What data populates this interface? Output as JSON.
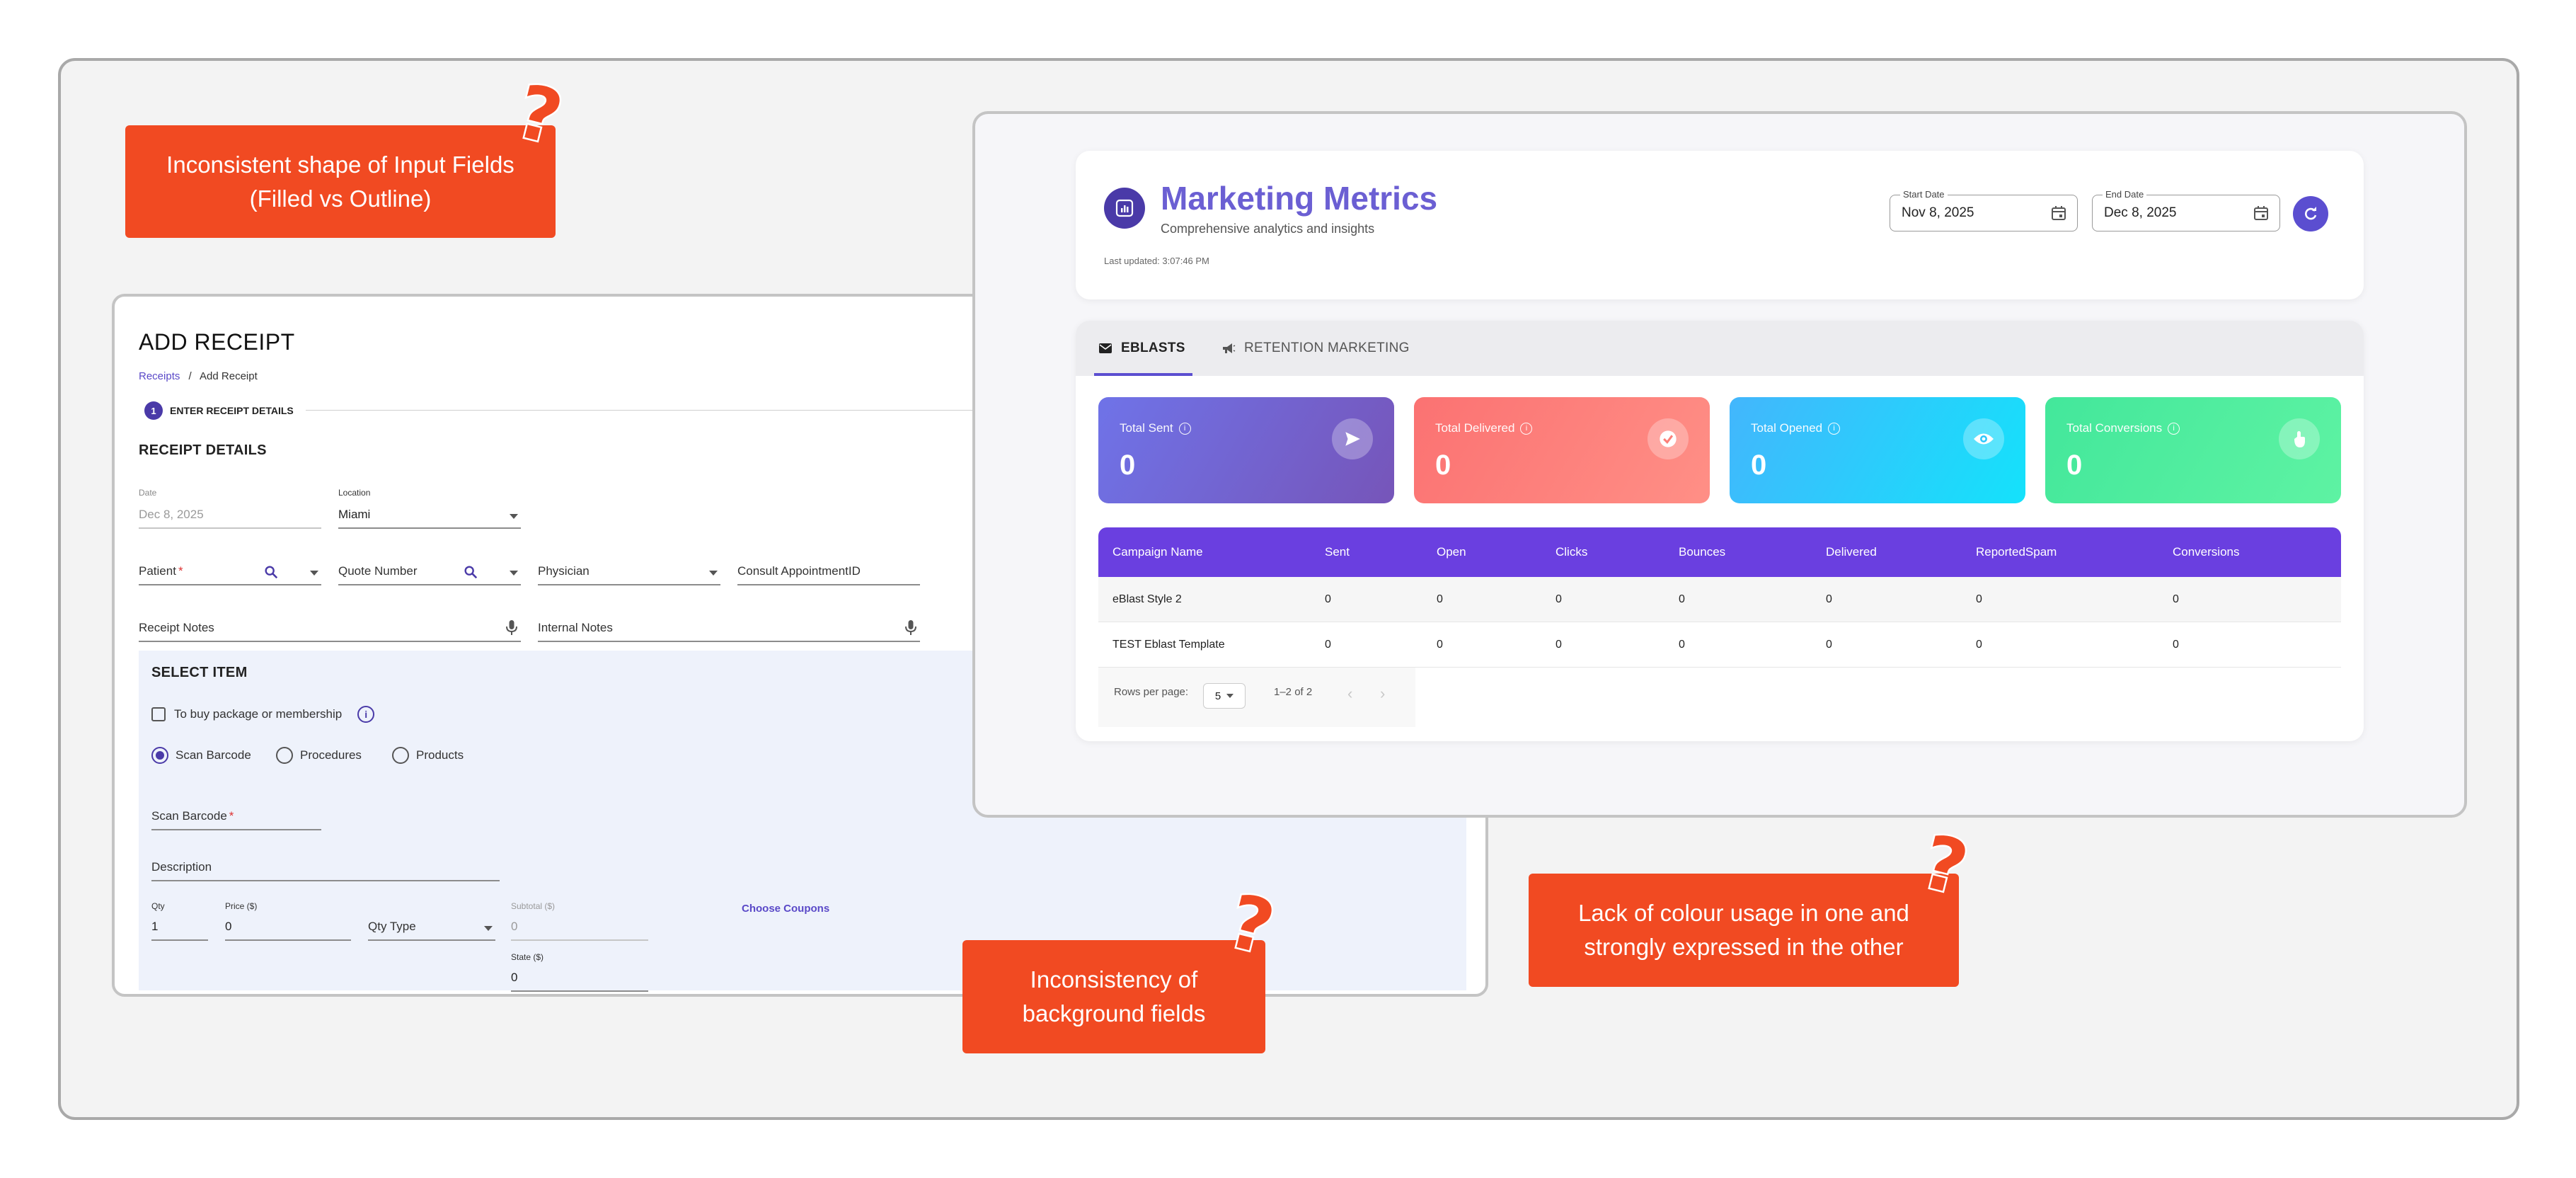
{
  "callouts": {
    "input_fields": "Inconsistent shape of Input Fields\n(Filled vs Outline)",
    "background_fields": "Inconsistency of\nbackground fields",
    "colour_usage": "Lack of colour usage in one and\nstrongly expressed in the other",
    "question_mark": "?"
  },
  "receipt": {
    "title": "ADD RECEIPT",
    "breadcrumb": {
      "link": "Receipts",
      "separator": "/",
      "current": "Add Receipt"
    },
    "step": {
      "number": "1",
      "label": "ENTER RECEIPT DETAILS"
    },
    "section_title": "RECEIPT DETAILS",
    "fields": {
      "date": {
        "label": "Date",
        "value": "Dec 8, 2025"
      },
      "location": {
        "label": "Location",
        "value": "Miami"
      },
      "patient": {
        "placeholder": "Patient",
        "required": "*"
      },
      "quote_number": {
        "placeholder": "Quote Number"
      },
      "physician": {
        "placeholder": "Physician"
      },
      "consult_appointment": {
        "placeholder": "Consult AppointmentID"
      },
      "receipt_notes": {
        "placeholder": "Receipt Notes"
      },
      "internal_notes": {
        "placeholder": "Internal Notes"
      }
    },
    "select_item": {
      "title": "SELECT ITEM",
      "package_checkbox": "To buy package or membership",
      "info": "i",
      "radios": [
        "Scan Barcode",
        "Procedures",
        "Products"
      ],
      "selected_radio": "Scan Barcode",
      "scan_barcode": {
        "placeholder": "Scan Barcode",
        "required": "*"
      },
      "description": {
        "placeholder": "Description"
      },
      "qty": {
        "label": "Qty",
        "value": "1"
      },
      "price": {
        "label": "Price ($)",
        "value": "0"
      },
      "qty_type": {
        "placeholder": "Qty Type"
      },
      "subtotal": {
        "label": "Subtotal ($)",
        "value": "0"
      },
      "state": {
        "label": "State ($)",
        "value": "0"
      },
      "choose_coupons": "Choose Coupons"
    }
  },
  "metrics": {
    "title": "Marketing Metrics",
    "subtitle": "Comprehensive analytics and insights",
    "last_updated": "Last updated: 3:07:46 PM",
    "start_date": {
      "label": "Start Date",
      "value": "Nov 8, 2025"
    },
    "end_date": {
      "label": "End Date",
      "value": "Dec 8, 2025"
    },
    "tabs": [
      {
        "label": "EBLASTS",
        "icon": "mail-icon",
        "active": true
      },
      {
        "label": "RETENTION MARKETING",
        "icon": "megaphone-icon",
        "active": false
      }
    ],
    "cards": [
      {
        "label": "Total Sent",
        "value": "0",
        "icon": "send-icon",
        "gradient_from": "#6f73e8",
        "gradient_to": "#7655b9"
      },
      {
        "label": "Total Delivered",
        "value": "0",
        "icon": "check-circle-icon",
        "gradient_from": "#fb7272",
        "gradient_to": "#ff8f86"
      },
      {
        "label": "Total Opened",
        "value": "0",
        "icon": "eye-icon",
        "gradient_from": "#43b6fc",
        "gradient_to": "#14e2fb"
      },
      {
        "label": "Total Conversions",
        "value": "0",
        "icon": "touch-icon",
        "gradient_from": "#43e79b",
        "gradient_to": "#5ef3a3"
      }
    ],
    "table": {
      "headers": [
        "Campaign Name",
        "Sent",
        "Open",
        "Clicks",
        "Bounces",
        "Delivered",
        "ReportedSpam",
        "Conversions"
      ],
      "rows": [
        [
          "eBlast Style 2",
          "0",
          "0",
          "0",
          "0",
          "0",
          "0",
          "0"
        ],
        [
          "TEST Eblast Template",
          "0",
          "0",
          "0",
          "0",
          "0",
          "0",
          "0"
        ]
      ]
    },
    "pagination": {
      "rows_per_page_label": "Rows per page:",
      "rows_per_page": "5",
      "range": "1–2 of 2",
      "prev": "‹",
      "next": "›"
    },
    "accent": "#6a3fe0"
  }
}
